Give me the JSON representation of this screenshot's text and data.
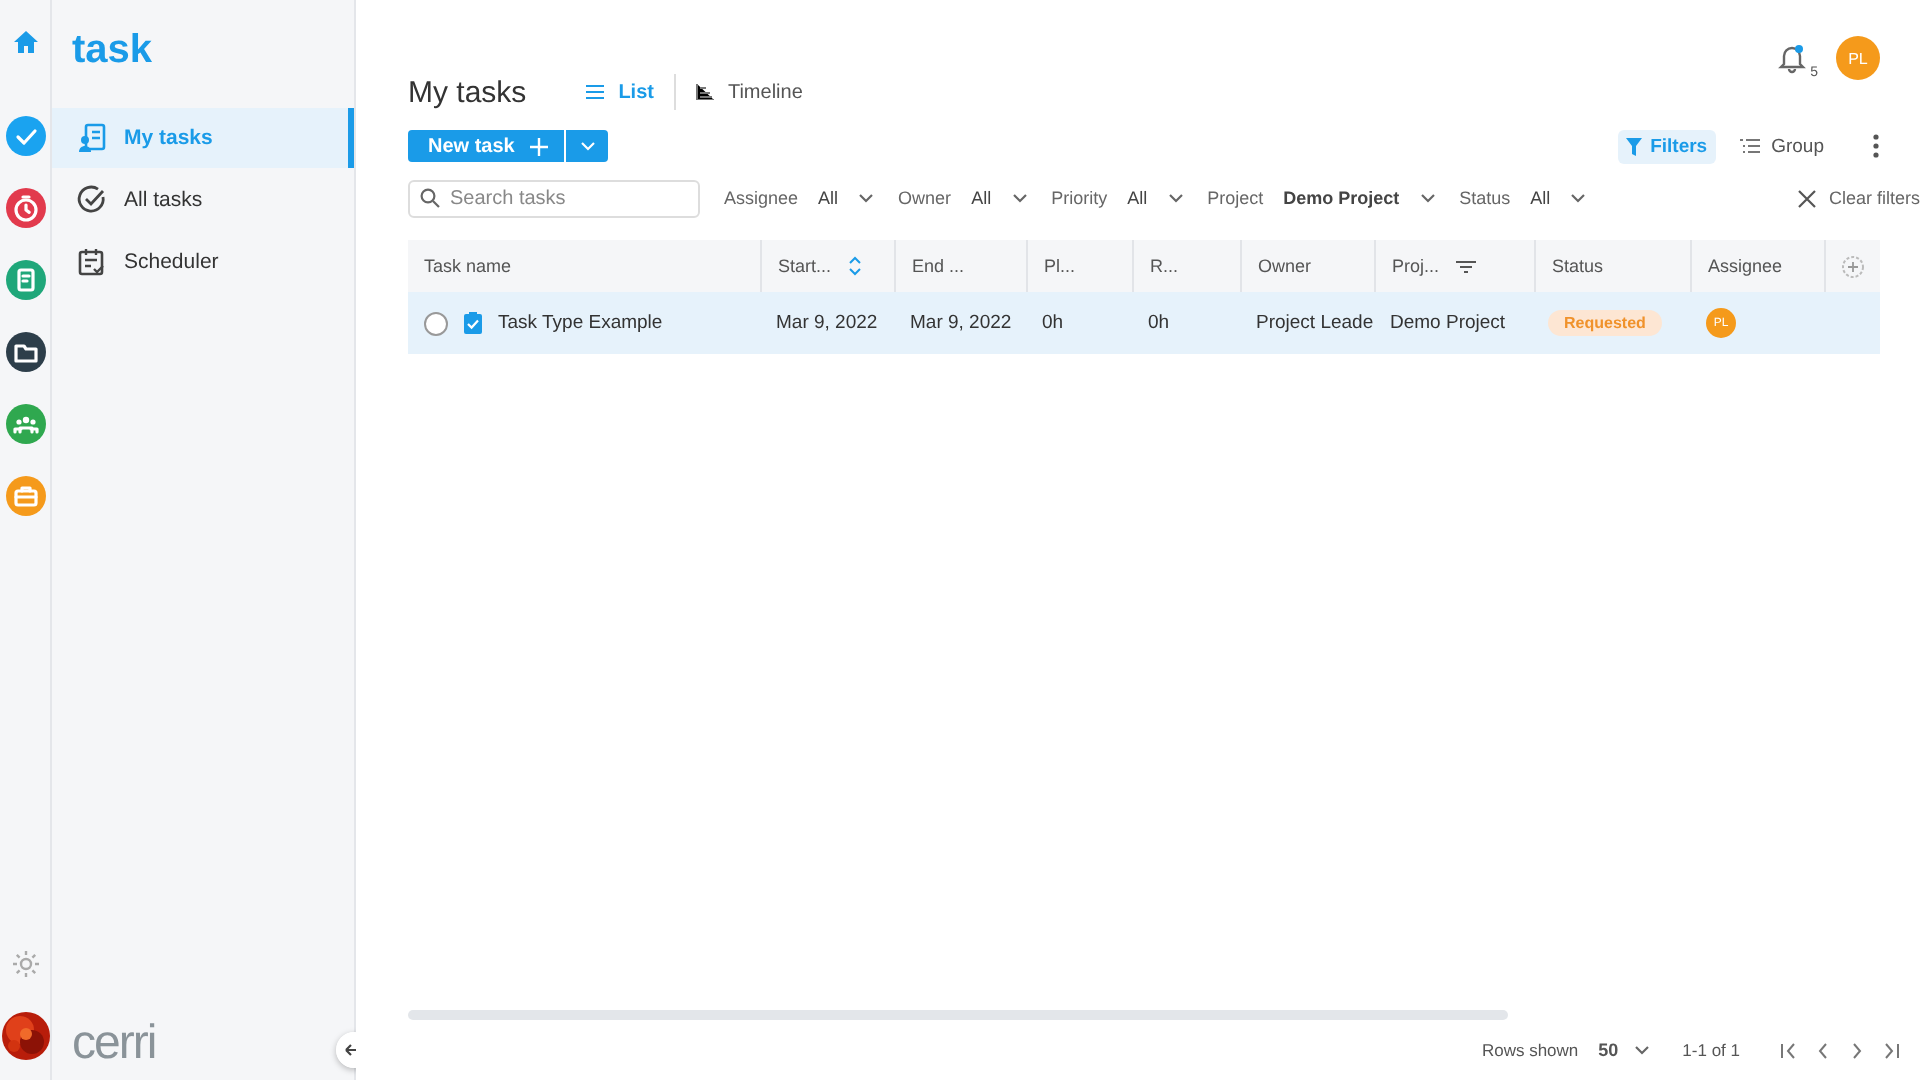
{
  "rail": {
    "items": [
      {
        "kind": "home",
        "color": "#1a9be8"
      },
      {
        "kind": "check",
        "color": "#1aa3f0"
      },
      {
        "kind": "timer",
        "color": "#e23a4d"
      },
      {
        "kind": "document",
        "color": "#1fa77a"
      },
      {
        "kind": "folder",
        "color": "#2d3e4a"
      },
      {
        "kind": "team",
        "color": "#2fa84f"
      },
      {
        "kind": "briefcase",
        "color": "#f59a1b"
      }
    ]
  },
  "nav": {
    "app_name": "task",
    "items": [
      {
        "label": "My tasks",
        "kind": "person",
        "selected": true
      },
      {
        "label": "All tasks",
        "kind": "check",
        "selected": false
      },
      {
        "label": "Scheduler",
        "kind": "calendar",
        "selected": false
      }
    ],
    "brand": "cerri"
  },
  "header": {
    "title": "My tasks",
    "views": [
      {
        "label": "List",
        "kind": "list",
        "selected": true
      },
      {
        "label": "Timeline",
        "kind": "timeline",
        "selected": false
      }
    ],
    "notification_count": "5",
    "user_initials": "PL"
  },
  "new_task_button": "New task",
  "toolbar": {
    "filters": {
      "label": "Filters",
      "active": true
    },
    "group": "Group"
  },
  "search": {
    "placeholder": "Search tasks"
  },
  "filters": [
    {
      "label": "Assignee",
      "value": "All"
    },
    {
      "label": "Owner",
      "value": "All"
    },
    {
      "label": "Priority",
      "value": "All"
    },
    {
      "label": "Project",
      "value": "Demo Project"
    },
    {
      "label": "Status",
      "value": "All"
    }
  ],
  "clear_filters": "Clear filters",
  "table": {
    "columns": [
      {
        "label": "Task name"
      },
      {
        "label": "Start...",
        "kind": "sort"
      },
      {
        "label": "End ..."
      },
      {
        "label": "Pl..."
      },
      {
        "label": "R..."
      },
      {
        "label": "Owner"
      },
      {
        "label": "Proj...",
        "kind": "filter"
      },
      {
        "label": "Status"
      },
      {
        "label": "Assignee"
      }
    ],
    "rows": [
      {
        "selected": true,
        "checked": false,
        "cells": [
          "Task Type Example",
          "Mar 9, 2022",
          "Mar 9, 2022",
          "0h",
          "0h",
          "Project Leade",
          "Demo Project"
        ],
        "status": "Requested",
        "assignee": "PL"
      }
    ]
  },
  "footer": {
    "rows_label": "Rows shown",
    "rows_value": "50",
    "range": "1-1 of 1"
  }
}
